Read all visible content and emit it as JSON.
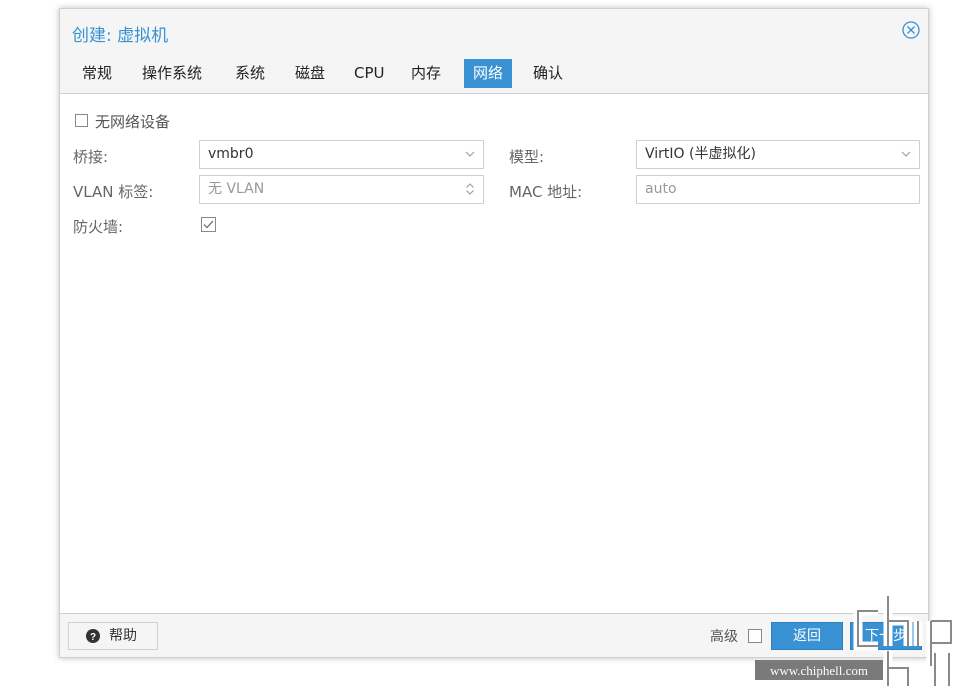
{
  "dialog": {
    "title": "创建: 虚拟机"
  },
  "tabs": [
    {
      "label": "常规",
      "active": false
    },
    {
      "label": "操作系统",
      "active": false
    },
    {
      "label": "系统",
      "active": false
    },
    {
      "label": "磁盘",
      "active": false
    },
    {
      "label": "CPU",
      "active": false
    },
    {
      "label": "内存",
      "active": false
    },
    {
      "label": "网络",
      "active": true
    },
    {
      "label": "确认",
      "active": false
    }
  ],
  "network": {
    "no_device_label": "无网络设备",
    "bridge_label": "桥接:",
    "bridge_value": "vmbr0",
    "vlan_label": "VLAN 标签:",
    "vlan_placeholder": "无 VLAN",
    "firewall_label": "防火墙:",
    "model_label": "模型:",
    "model_value": "VirtIO (半虚拟化)",
    "mac_label": "MAC 地址:",
    "mac_placeholder": "auto"
  },
  "footer": {
    "help_label": "帮助",
    "advanced_label": "高级",
    "back_label": "返回",
    "next_label": "下一步"
  },
  "watermark": {
    "brand": "chip hell",
    "url": "www.chiphell.com"
  },
  "colors": {
    "accent": "#3892d4"
  }
}
